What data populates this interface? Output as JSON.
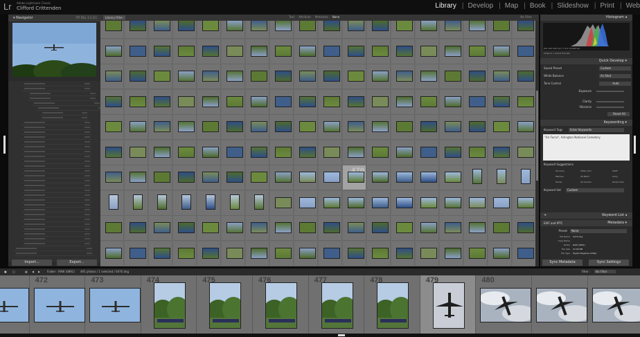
{
  "app": {
    "logo": "Lr",
    "name": "Adobe Lightroom Classic",
    "user": "Clifford Crittenden"
  },
  "modules": [
    {
      "label": "Library",
      "active": true
    },
    {
      "label": "Develop",
      "active": false
    },
    {
      "label": "Map",
      "active": false
    },
    {
      "label": "Book",
      "active": false
    },
    {
      "label": "Slideshow",
      "active": false
    },
    {
      "label": "Print",
      "active": false
    },
    {
      "label": "Web",
      "active": false
    }
  ],
  "navigator": {
    "title": "Navigator",
    "zoom": "FIT  FILL  1:1  3:1"
  },
  "left_panel": {
    "import_label": "Import...",
    "export_label": "Export..."
  },
  "library_filter": {
    "title": "Library Filter :",
    "tabs": [
      "Text",
      "Attribute",
      "Metadata",
      "None"
    ],
    "selected": "None",
    "preset": "No Filter"
  },
  "grid": {
    "selected_number": "470"
  },
  "right_panel": {
    "histogram_title": "Histogram",
    "histogram_info": "ISO 100   200 mm   f / 8.0   1/1000 sec",
    "preview_label": "Original + Smart Preview",
    "quick_develop": {
      "title": "Quick Develop",
      "saved_preset_label": "Saved Preset",
      "saved_preset_value": "Custom",
      "white_balance_label": "White Balance",
      "white_balance_value": "As Shot",
      "tone_control_label": "Tone Control",
      "tone_control_value": "Auto",
      "exposure_label": "Exposure",
      "clarity_label": "Clarity",
      "vibrance_label": "Vibrance",
      "reset_label": "Reset All"
    },
    "keywording": {
      "title": "Keywording",
      "tags_label": "Keyword Tags",
      "tags_mode": "Enter Keywords",
      "keywords_text": "\"Air Force\", Arlington National Cemetery",
      "suggestions_label": "Keyword Suggestions",
      "suggestions": [
        "US Army",
        "2002 color",
        "USAF",
        "Marines",
        "US NAVY",
        "Army",
        "family",
        "US Airman",
        "Ghost Cam"
      ],
      "set_label": "Keyword Set",
      "set_value": "Custom"
    },
    "keyword_list": {
      "title": "Keyword List"
    },
    "metadata": {
      "title": "Metadata",
      "mode": "EXIF and IPTC",
      "preset_label": "Preset",
      "preset_value": "None",
      "rows": [
        {
          "k": "File Name",
          "v": "0470.dng"
        },
        {
          "k": "Copy Name",
          "v": ""
        },
        {
          "k": "Folder",
          "v": "RAW (0891)"
        },
        {
          "k": "File Size",
          "v": "23.46 MB"
        },
        {
          "k": "File Type",
          "v": "Digital Negative (DNG)"
        }
      ]
    },
    "sync_metadata_label": "Sync Metadata",
    "sync_settings_label": "Sync Settings"
  },
  "filmstrip_bar": {
    "folder": "Folder : RAW (0891)",
    "count": "491 photos / 1 selected / 0470.dng",
    "filter_label": "Filter :",
    "filter_value": "No Filter"
  },
  "filmstrip": [
    {
      "num": "",
      "kind": "sky-plane"
    },
    {
      "num": "472",
      "kind": "sky-plane"
    },
    {
      "num": "473",
      "kind": "sky-plane"
    },
    {
      "num": "474",
      "kind": "trees"
    },
    {
      "num": "475",
      "kind": "trees"
    },
    {
      "num": "476",
      "kind": "trees"
    },
    {
      "num": "477",
      "kind": "trees"
    },
    {
      "num": "478",
      "kind": "trees"
    },
    {
      "num": "479",
      "kind": "plane-up"
    },
    {
      "num": "480",
      "kind": "cloud-plane"
    },
    {
      "num": "",
      "kind": "cloud-plane"
    },
    {
      "num": "",
      "kind": "cloud-plane"
    }
  ]
}
